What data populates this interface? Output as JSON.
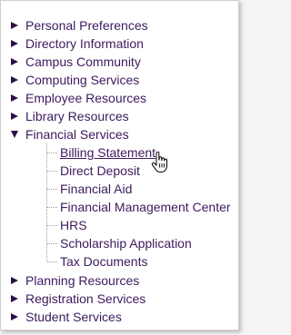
{
  "nav": {
    "items_before": [
      {
        "label": "Personal Preferences",
        "icon": "triangle-right-icon"
      },
      {
        "label": "Directory Information",
        "icon": "triangle-right-icon"
      },
      {
        "label": "Campus Community",
        "icon": "triangle-right-icon"
      },
      {
        "label": "Computing Services",
        "icon": "triangle-right-icon"
      },
      {
        "label": "Employee Resources",
        "icon": "triangle-right-icon"
      },
      {
        "label": "Library Resources",
        "icon": "triangle-right-icon"
      }
    ],
    "expanded": {
      "label": "Financial Services",
      "icon": "triangle-down-icon",
      "children": [
        "Billing Statement",
        "Direct Deposit",
        "Financial Aid",
        "Financial Management Center",
        "HRS",
        "Scholarship Application",
        "Tax Documents"
      ],
      "hovered_child": "Billing Statement"
    },
    "items_after": [
      {
        "label": "Planning Resources",
        "icon": "triangle-right-icon"
      },
      {
        "label": "Registration Services",
        "icon": "triangle-right-icon"
      },
      {
        "label": "Student Services",
        "icon": "triangle-right-icon"
      }
    ]
  },
  "colors": {
    "text": "#3c1a5e",
    "arrow": "#2c1144",
    "tree_line": "#9a9a9a"
  }
}
